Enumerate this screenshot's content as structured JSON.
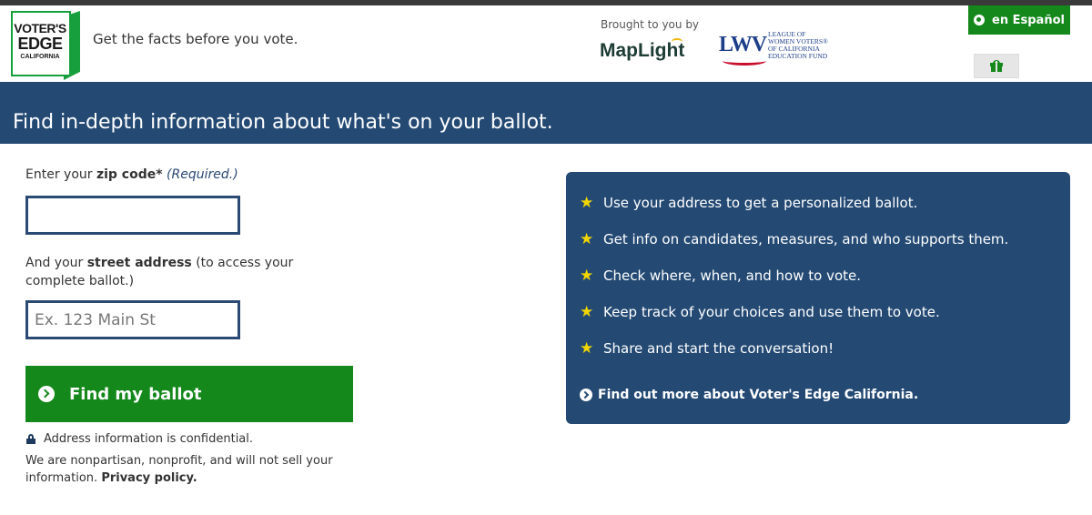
{
  "header": {
    "logo": {
      "line1": "VOTER'S",
      "line2": "EDGE",
      "line3": "CALIFORNIA"
    },
    "tagline": "Get the facts before you vote.",
    "brought_by": "Brought to you by",
    "maplight": "MapLight",
    "lwv": {
      "mark": "LWV",
      "text": "LEAGUE OF\nWOMEN VOTERS®\nOF CALIFORNIA\nEDUCATION FUND"
    },
    "language_button": "en Español"
  },
  "banner": {
    "title": "Find in-depth information about what's on your ballot."
  },
  "form": {
    "zip": {
      "prefix": "Enter your ",
      "strong": "zip code*",
      "required": "(Required.)",
      "value": ""
    },
    "street": {
      "prefix": "And your ",
      "strong": "street address",
      "suffix": " (to access your complete ballot.)",
      "placeholder": "Ex. 123 Main St",
      "value": ""
    },
    "submit_label": "Find my ballot",
    "confidential": "Address information is confidential.",
    "nonpartisan": "We are nonpartisan, nonprofit, and will not sell your information.",
    "privacy_link": "Privacy policy."
  },
  "panel": {
    "items": [
      "Use your address to get a personalized ballot.",
      "Get info on candidates, measures, and who supports them.",
      "Check where, when, and how to vote.",
      "Keep track of your choices and use them to vote.",
      "Share and start the conversation!"
    ],
    "more_link": "Find out more about Voter's Edge California."
  },
  "colors": {
    "brand_green": "#15881c",
    "navy": "#244a74",
    "star": "#f2d600"
  }
}
